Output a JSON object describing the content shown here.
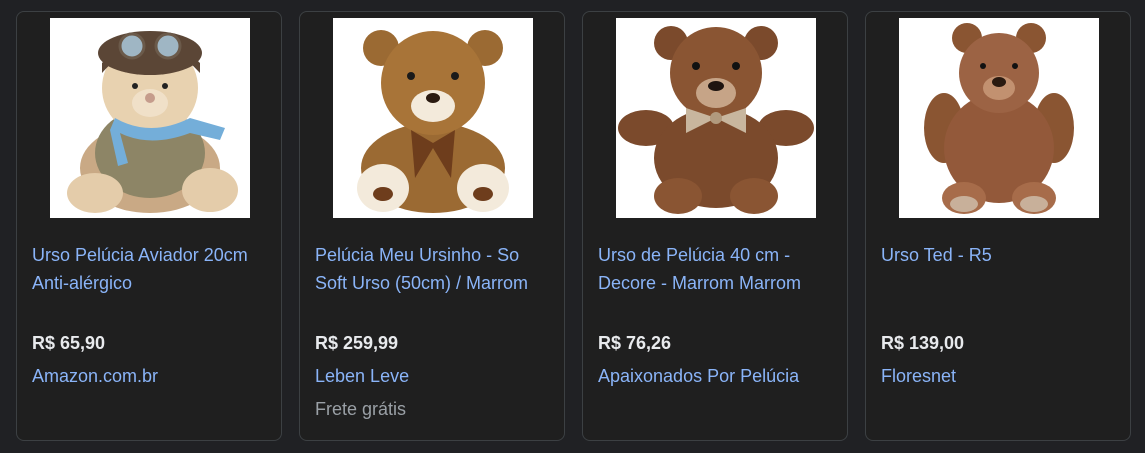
{
  "products": [
    {
      "image_alt": "urso-aviador",
      "title": "Urso Pelúcia Aviador 20cm Anti-alérgico",
      "price": "R$ 65,90",
      "store": "Amazon.com.br",
      "extra": ""
    },
    {
      "image_alt": "urso-marrom-claro",
      "title": "Pelúcia Meu Ursinho - So Soft Urso (50cm) / Marrom",
      "price": "R$ 259,99",
      "store": "Leben Leve",
      "extra": "Frete grátis"
    },
    {
      "image_alt": "urso-laco-xadrez",
      "title": "Urso de Pelúcia 40 cm - Decore - Marrom Marrom",
      "price": "R$ 76,26",
      "store": "Apaixonados Por Pelúcia",
      "extra": ""
    },
    {
      "image_alt": "urso-ted",
      "title": "Urso Ted - R5",
      "price": "R$ 139,00",
      "store": "Floresnet",
      "extra": ""
    }
  ],
  "colors": {
    "background": "#202124",
    "link": "#8ab4f8",
    "price": "#e8eaed",
    "muted": "#9aa0a6",
    "border": "#3c4043"
  }
}
